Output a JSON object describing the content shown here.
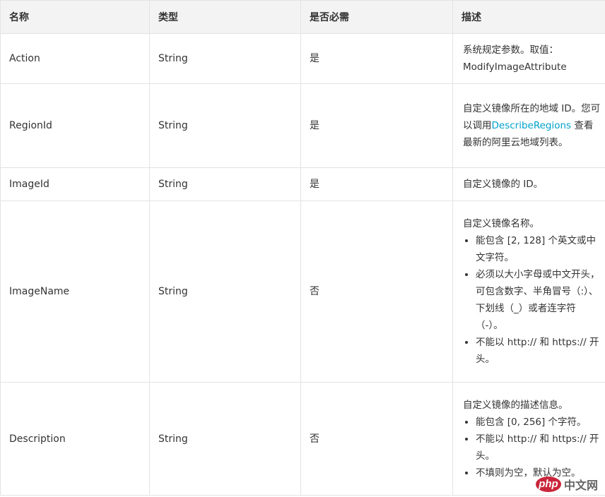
{
  "table": {
    "headers": [
      "名称",
      "类型",
      "是否必需",
      "描述"
    ],
    "rows": [
      {
        "name": "Action",
        "type": "String",
        "required": "是",
        "desc": {
          "text": "系统规定参数。取值：ModifyImageAttribute",
          "items": []
        }
      },
      {
        "name": "RegionId",
        "type": "String",
        "required": "是",
        "desc": {
          "text": "自定义镜像所在的地域 ID。您可以调用",
          "link": "DescribeRegions",
          "text_after": " 查看最新的阿里云地域列表。",
          "items": []
        }
      },
      {
        "name": "ImageId",
        "type": "String",
        "required": "是",
        "desc": {
          "text": "自定义镜像的 ID。",
          "items": []
        }
      },
      {
        "name": "ImageName",
        "type": "String",
        "required": "否",
        "desc": {
          "text": "自定义镜像名称。",
          "items": [
            "能包含 [2, 128] 个英文或中文字符。",
            "必须以大小字母或中文开头，可包含数字、半角冒号（:）、下划线（_）或者连字符（-）。",
            "不能以 http:// 和 https:// 开头。"
          ]
        }
      },
      {
        "name": "Description",
        "type": "String",
        "required": "否",
        "desc": {
          "text": "自定义镜像的描述信息。",
          "items": [
            "能包含 [0, 256] 个字符。",
            "不能以 http:// 和 https:// 开头。",
            "不填则为空，默认为空。"
          ]
        }
      }
    ]
  },
  "watermark": {
    "logo": "php",
    "text": "中文网"
  },
  "colors": {
    "header_bg": "#f3f3f3",
    "border": "#e3e3e3",
    "link": "#00a2ca",
    "text": "#333333"
  }
}
